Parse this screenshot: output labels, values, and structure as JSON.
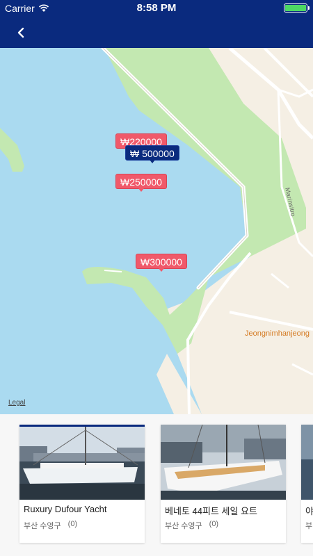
{
  "status_bar": {
    "carrier": "Carrier",
    "time": "8:58 PM"
  },
  "map": {
    "street_label": "Marinsitro",
    "poi_label": "Jeongnimhanjeong",
    "legal": "Legal",
    "markers": [
      {
        "text": "₩220000",
        "color": "red"
      },
      {
        "text": "₩ 500000",
        "color": "blue"
      },
      {
        "text": "₩250000",
        "color": "red"
      },
      {
        "text": "₩300000",
        "color": "red"
      }
    ]
  },
  "cards": [
    {
      "title": "Ruxury Dufour Yacht",
      "location": "부산 수영구",
      "count": "(0)"
    },
    {
      "title": "베네토 44피트 세일 요트",
      "location": "부산 수영구",
      "count": "(0)"
    },
    {
      "title": "야",
      "location": "부",
      "count": ""
    }
  ],
  "colors": {
    "header": "#0a2a7e",
    "water": "#aadaf0",
    "park": "#c3e8b1",
    "land": "#f5efe4",
    "marker_red": "#f0596a",
    "marker_blue": "#0a2a7e"
  }
}
